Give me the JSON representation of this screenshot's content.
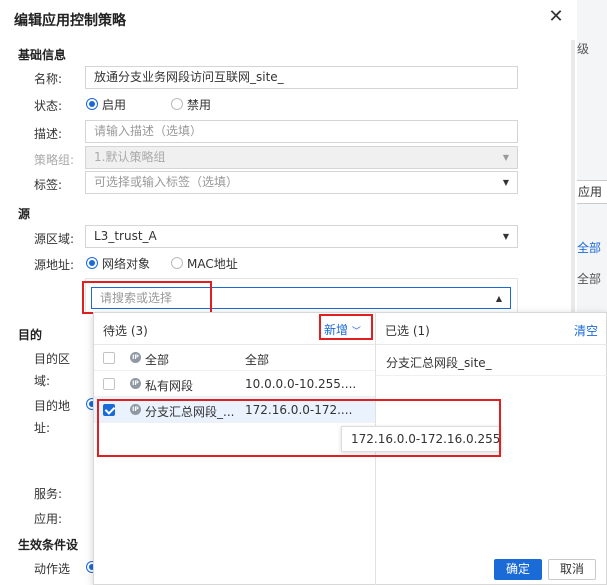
{
  "background": {
    "texts": [
      "级",
      "应用",
      "全部",
      "全部"
    ]
  },
  "dialog": {
    "title": "编辑应用控制策略",
    "sections": {
      "basic": "基础信息",
      "source": "源",
      "dest": "目的",
      "effect": "生效条件设"
    },
    "labels": {
      "name": "名称:",
      "status": "状态:",
      "desc": "描述:",
      "group": "策略组:",
      "tag": "标签:",
      "src_zone": "源区域:",
      "src_addr": "源地址:",
      "dst_zone_1": "目的区",
      "dst_zone_2": "域:",
      "dst_addr_1": "目的地",
      "dst_addr_2": "址:",
      "service": "服务:",
      "app": "应用:",
      "action": "动作选"
    },
    "fields": {
      "name_value": "放通分支业务网段访问互联网_site_",
      "desc_placeholder": "请输入描述（选填）",
      "group_value": "1.默认策略组",
      "tag_placeholder": "可选择或输入标签（选填）",
      "src_zone_value": "L3_trust_A",
      "search_placeholder": "请搜索或选择"
    },
    "status_options": [
      {
        "label": "启用",
        "checked": true
      },
      {
        "label": "禁用",
        "checked": false
      }
    ],
    "src_addr_options": [
      {
        "label": "网络对象",
        "checked": true
      },
      {
        "label": "MAC地址",
        "checked": false
      }
    ]
  },
  "popup": {
    "left_title": "待选 (3)",
    "new_label": "新增",
    "right_title": "已选 (1)",
    "clear_label": "清空",
    "rows": [
      {
        "name": "全部",
        "value": "全部",
        "checked": false,
        "ip_icon": true
      },
      {
        "name": "私有网段",
        "value": "10.0.0.0-10.255....",
        "checked": false,
        "ip_icon": true
      },
      {
        "name": "分支汇总网段_...",
        "value": "172.16.0.0-172....",
        "checked": true,
        "ip_icon": true
      }
    ],
    "ip_icon_text": "IP",
    "selected": [
      "分支汇总网段_site_"
    ],
    "tooltip": "172.16.0.0-172.16.0.255",
    "ok_label": "确定",
    "cancel_label": "取消"
  }
}
